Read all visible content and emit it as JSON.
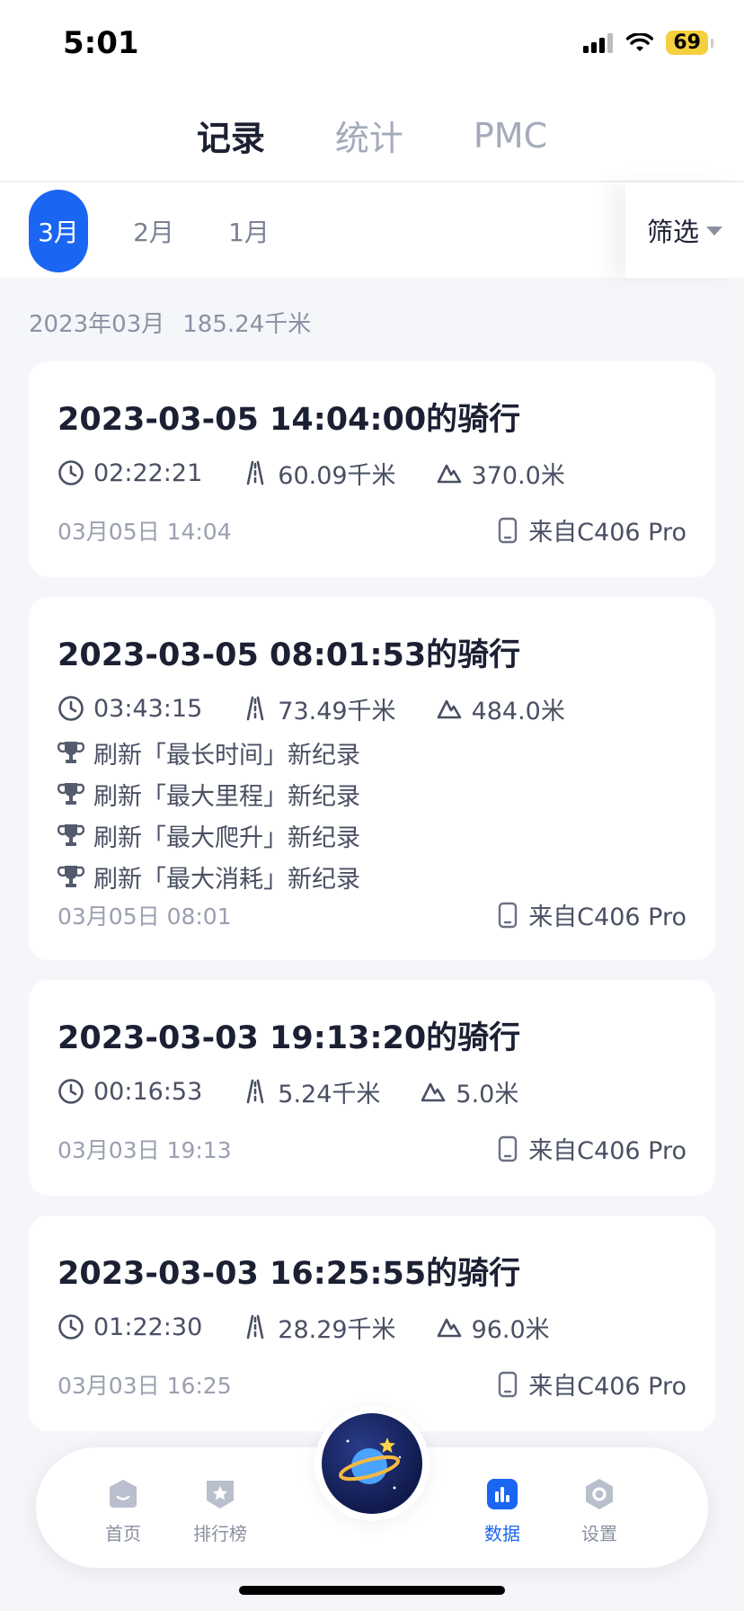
{
  "status_bar": {
    "time": "5:01",
    "battery": "69"
  },
  "top_tabs": [
    {
      "label": "记录",
      "active": true
    },
    {
      "label": "统计",
      "active": false
    },
    {
      "label": "PMC",
      "active": false
    }
  ],
  "months": [
    {
      "label": "3月",
      "active": true
    },
    {
      "label": "2月",
      "active": false
    },
    {
      "label": "1月",
      "active": false
    }
  ],
  "filter": {
    "label": "筛选"
  },
  "summary": {
    "month": "2023年03月",
    "distance": "185.24千米"
  },
  "rides": [
    {
      "title": "2023-03-05 14:04:00的骑行",
      "duration": "02:22:21",
      "distance": "60.09千米",
      "climb": "370.0米",
      "records": [],
      "date": "03月05日 14:04",
      "source": "来自C406 Pro"
    },
    {
      "title": "2023-03-05 08:01:53的骑行",
      "duration": "03:43:15",
      "distance": "73.49千米",
      "climb": "484.0米",
      "records": [
        "刷新「最长时间」新纪录",
        "刷新「最大里程」新纪录",
        "刷新「最大爬升」新纪录",
        "刷新「最大消耗」新纪录"
      ],
      "date": "03月05日 08:01",
      "source": "来自C406 Pro"
    },
    {
      "title": "2023-03-03 19:13:20的骑行",
      "duration": "00:16:53",
      "distance": "5.24千米",
      "climb": "5.0米",
      "records": [],
      "date": "03月03日 19:13",
      "source": "来自C406 Pro"
    },
    {
      "title": "2023-03-03 16:25:55的骑行",
      "duration": "01:22:30",
      "distance": "28.29千米",
      "climb": "96.0米",
      "records": [],
      "date": "03月03日 16:25",
      "source": "来自C406 Pro"
    }
  ],
  "bottom_nav": [
    {
      "label": "首页",
      "icon": "home-icon",
      "active": false
    },
    {
      "label": "排行榜",
      "icon": "ranking-icon",
      "active": false
    },
    {
      "label": "数据",
      "icon": "data-icon",
      "active": true
    },
    {
      "label": "设置",
      "icon": "settings-icon",
      "active": false
    }
  ],
  "colors": {
    "accent": "#1a66f2",
    "text": "#1c2033",
    "muted": "#9aa0b0"
  }
}
